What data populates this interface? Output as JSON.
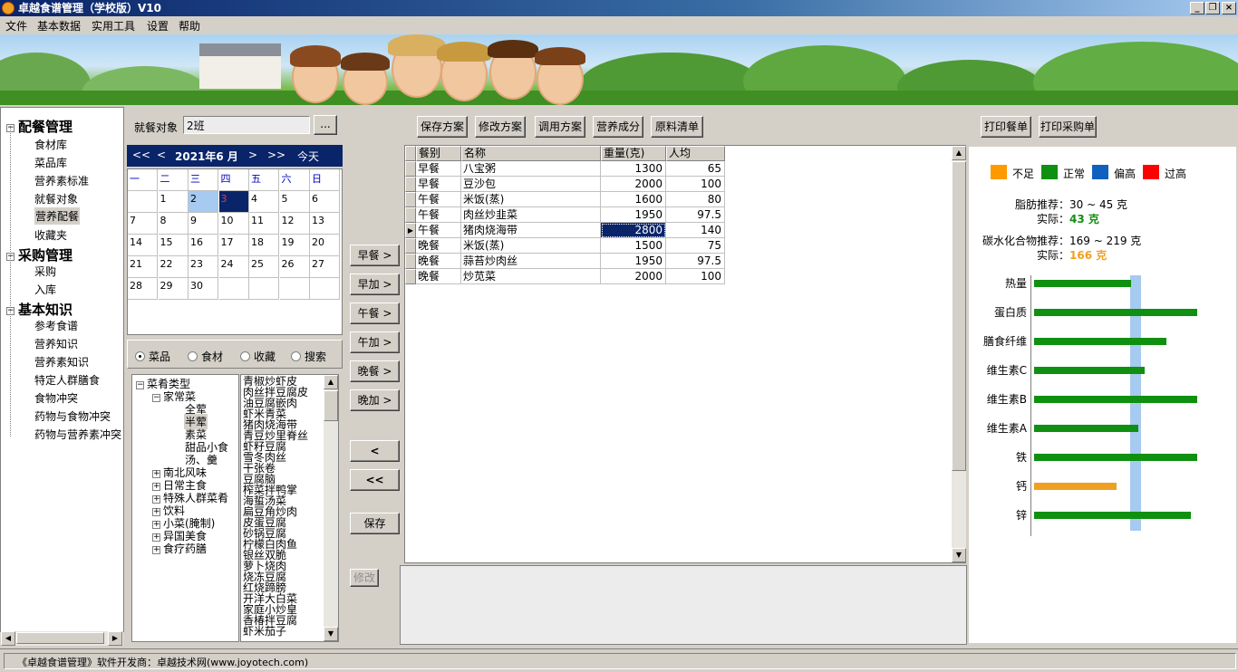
{
  "window": {
    "title": "卓越食谱管理（学校版）V10"
  },
  "menu": [
    "文件",
    "基本数据",
    "实用工具",
    "设置",
    "帮助"
  ],
  "nav": {
    "groups": [
      {
        "label": "配餐管理",
        "items": [
          "食材库",
          "菜品库",
          "营养素标准",
          "就餐对象",
          "营养配餐",
          "收藏夹"
        ]
      },
      {
        "label": "采购管理",
        "items": [
          "采购",
          "入库"
        ]
      },
      {
        "label": "基本知识",
        "items": [
          "参考食谱",
          "营养知识",
          "营养素知识",
          "特定人群膳食",
          "食物冲突",
          "药物与食物冲突",
          "药物与营养素冲突"
        ]
      }
    ],
    "selected": "营养配餐"
  },
  "diner": {
    "label": "就餐对象",
    "value": "2班",
    "browse": "..."
  },
  "calendar": {
    "prev_year": "<<",
    "prev_month": "<",
    "title": "2021年6 月",
    "next_month": ">",
    "next_year": ">>",
    "today": "今天",
    "weekdays": [
      "一",
      "二",
      "三",
      "四",
      "五",
      "六",
      "日"
    ],
    "rows": [
      [
        "",
        "1",
        "2",
        "3",
        "4",
        "5",
        "6"
      ],
      [
        "7",
        "8",
        "9",
        "10",
        "11",
        "12",
        "13"
      ],
      [
        "14",
        "15",
        "16",
        "17",
        "18",
        "19",
        "20"
      ],
      [
        "21",
        "22",
        "23",
        "24",
        "25",
        "26",
        "27"
      ],
      [
        "28",
        "29",
        "30",
        "",
        "",
        "",
        ""
      ]
    ]
  },
  "filter": {
    "options": [
      "菜品",
      "食材",
      "收藏",
      "搜索"
    ],
    "selected": "菜品"
  },
  "dish_tree": {
    "root": "菜肴类型",
    "home": "家常菜",
    "home_children": [
      "全荤",
      "半荤",
      "素菜",
      "甜品小食",
      "汤、羹"
    ],
    "selected": "半荤",
    "others": [
      "南北风味",
      "日常主食",
      "特殊人群菜肴",
      "饮料",
      "小菜(腌制)",
      "异国美食",
      "食疗药膳"
    ]
  },
  "dish_list": [
    "青椒炒虾皮",
    "肉丝拌豆腐皮",
    "油豆腐嵌肉",
    "虾米青菜",
    "猪肉烧海带",
    "青豆炒里脊丝",
    "虾籽豆腐",
    "雪冬肉丝",
    "干张卷",
    "豆腐脑",
    "榨菜拌鸭掌",
    "海蜇汤菜",
    "扁豆角炒肉",
    "皮蛋豆腐",
    "砂锅豆腐",
    "柠檬白肉鱼",
    "银丝双脆",
    "萝卜烧肉",
    "烧冻豆腐",
    "红烧蹄膀",
    "开洋大白菜",
    "家庭小炒皇",
    "香椿拌豆腐",
    "虾米茄子"
  ],
  "side_buttons": [
    "早餐 >",
    "早加 >",
    "午餐 >",
    "午加 >",
    "晚餐 >",
    "晚加 >"
  ],
  "remove_buttons": [
    "<",
    "<<"
  ],
  "save_button": "保存",
  "edit_button": "修改",
  "toolbar": [
    "保存方案",
    "修改方案",
    "调用方案",
    "营养成分",
    "原料清单"
  ],
  "print_buttons": [
    "打印餐单",
    "打印采购单"
  ],
  "table": {
    "headers": [
      "餐别",
      "名称",
      "重量(克)",
      "人均"
    ],
    "rows": [
      [
        "早餐",
        "八宝粥",
        "1300",
        "65"
      ],
      [
        "早餐",
        "豆沙包",
        "2000",
        "100"
      ],
      [
        "午餐",
        "米饭(蒸)",
        "1600",
        "80"
      ],
      [
        "午餐",
        "肉丝炒韭菜",
        "1950",
        "97.5"
      ],
      [
        "午餐",
        "猪肉烧海带",
        "2800",
        "140"
      ],
      [
        "晚餐",
        "米饭(蒸)",
        "1500",
        "75"
      ],
      [
        "晚餐",
        "蒜苔炒肉丝",
        "1950",
        "97.5"
      ],
      [
        "晚餐",
        "炒苋菜",
        "2000",
        "100"
      ]
    ],
    "selected_row": 4
  },
  "legend": [
    {
      "label": "不足",
      "color": "#ff9900"
    },
    {
      "label": "正常",
      "color": "#109010"
    },
    {
      "label": "偏高",
      "color": "#1060c0"
    },
    {
      "label": "过高",
      "color": "#ff0000"
    }
  ],
  "fat": {
    "label": "脂肪推荐：",
    "range": "30 ~ 45 克",
    "actual_label": "实际：",
    "actual": "43 克",
    "actual_color": "#109010"
  },
  "carb": {
    "label": "碳水化合物推荐：",
    "range": "169 ~ 219 克",
    "actual_label": "实际：",
    "actual": "166 克",
    "actual_color": "#f0a020"
  },
  "nutrients": [
    {
      "name": "热量",
      "ratio": 0.59,
      "color": "#109010"
    },
    {
      "name": "蛋白质",
      "ratio": 0.99,
      "color": "#109010"
    },
    {
      "name": "膳食纤维",
      "ratio": 0.8,
      "color": "#109010"
    },
    {
      "name": "维生素C",
      "ratio": 0.67,
      "color": "#109010"
    },
    {
      "name": "维生素B",
      "ratio": 0.99,
      "color": "#109010"
    },
    {
      "name": "维生素A",
      "ratio": 0.63,
      "color": "#109010"
    },
    {
      "name": "铁",
      "ratio": 0.99,
      "color": "#109010"
    },
    {
      "name": "钙",
      "ratio": 0.5,
      "color": "#f0a020"
    },
    {
      "name": "锌",
      "ratio": 0.95,
      "color": "#109010"
    }
  ],
  "status": "《卓越食谱管理》软件开发商：卓越技术网(www.joyotech.com)"
}
